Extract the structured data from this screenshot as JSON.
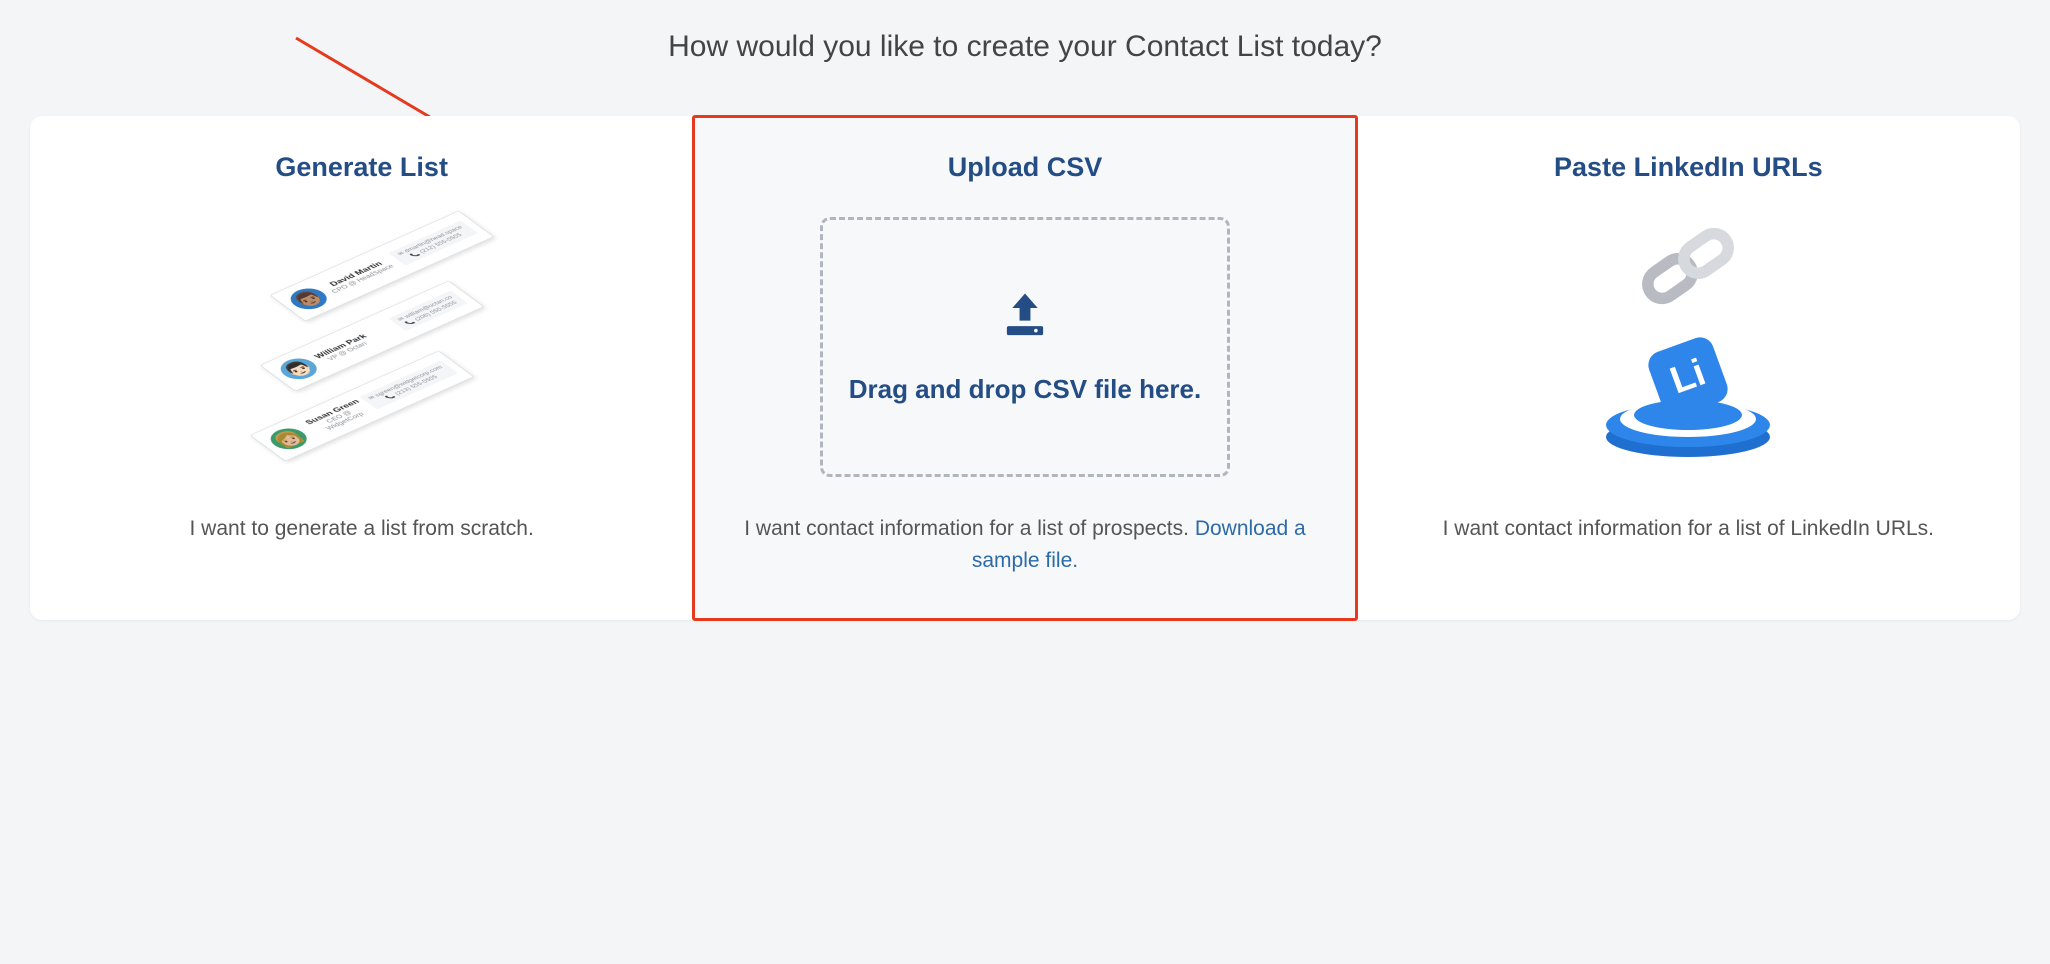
{
  "heading": "How would you like to create your Contact List today?",
  "options": {
    "generate": {
      "title": "Generate List",
      "desc": "I want to generate a list from scratch.",
      "contacts": [
        {
          "name": "David Martin",
          "sub": "CPO @ HeadSpace",
          "email": "dmartin@head.space",
          "phone": "(212) 555-5555"
        },
        {
          "name": "William Park",
          "sub": "VP @ Octan",
          "email": "william@octan.co",
          "phone": "(206) 555-5555"
        },
        {
          "name": "Susan Green",
          "sub": "CEO @ WidgetCorp",
          "email": "sgreen@widgetcorp.com",
          "phone": "(213) 555-5555"
        }
      ]
    },
    "upload": {
      "title": "Upload CSV",
      "dropzone_text": "Drag and drop CSV file here.",
      "desc_prefix": "I want contact information for a list of prospects. ",
      "download_link": "Download a sample file."
    },
    "linkedin": {
      "title": "Paste LinkedIn URLs",
      "desc": "I want contact information for a list of LinkedIn URLs."
    }
  }
}
